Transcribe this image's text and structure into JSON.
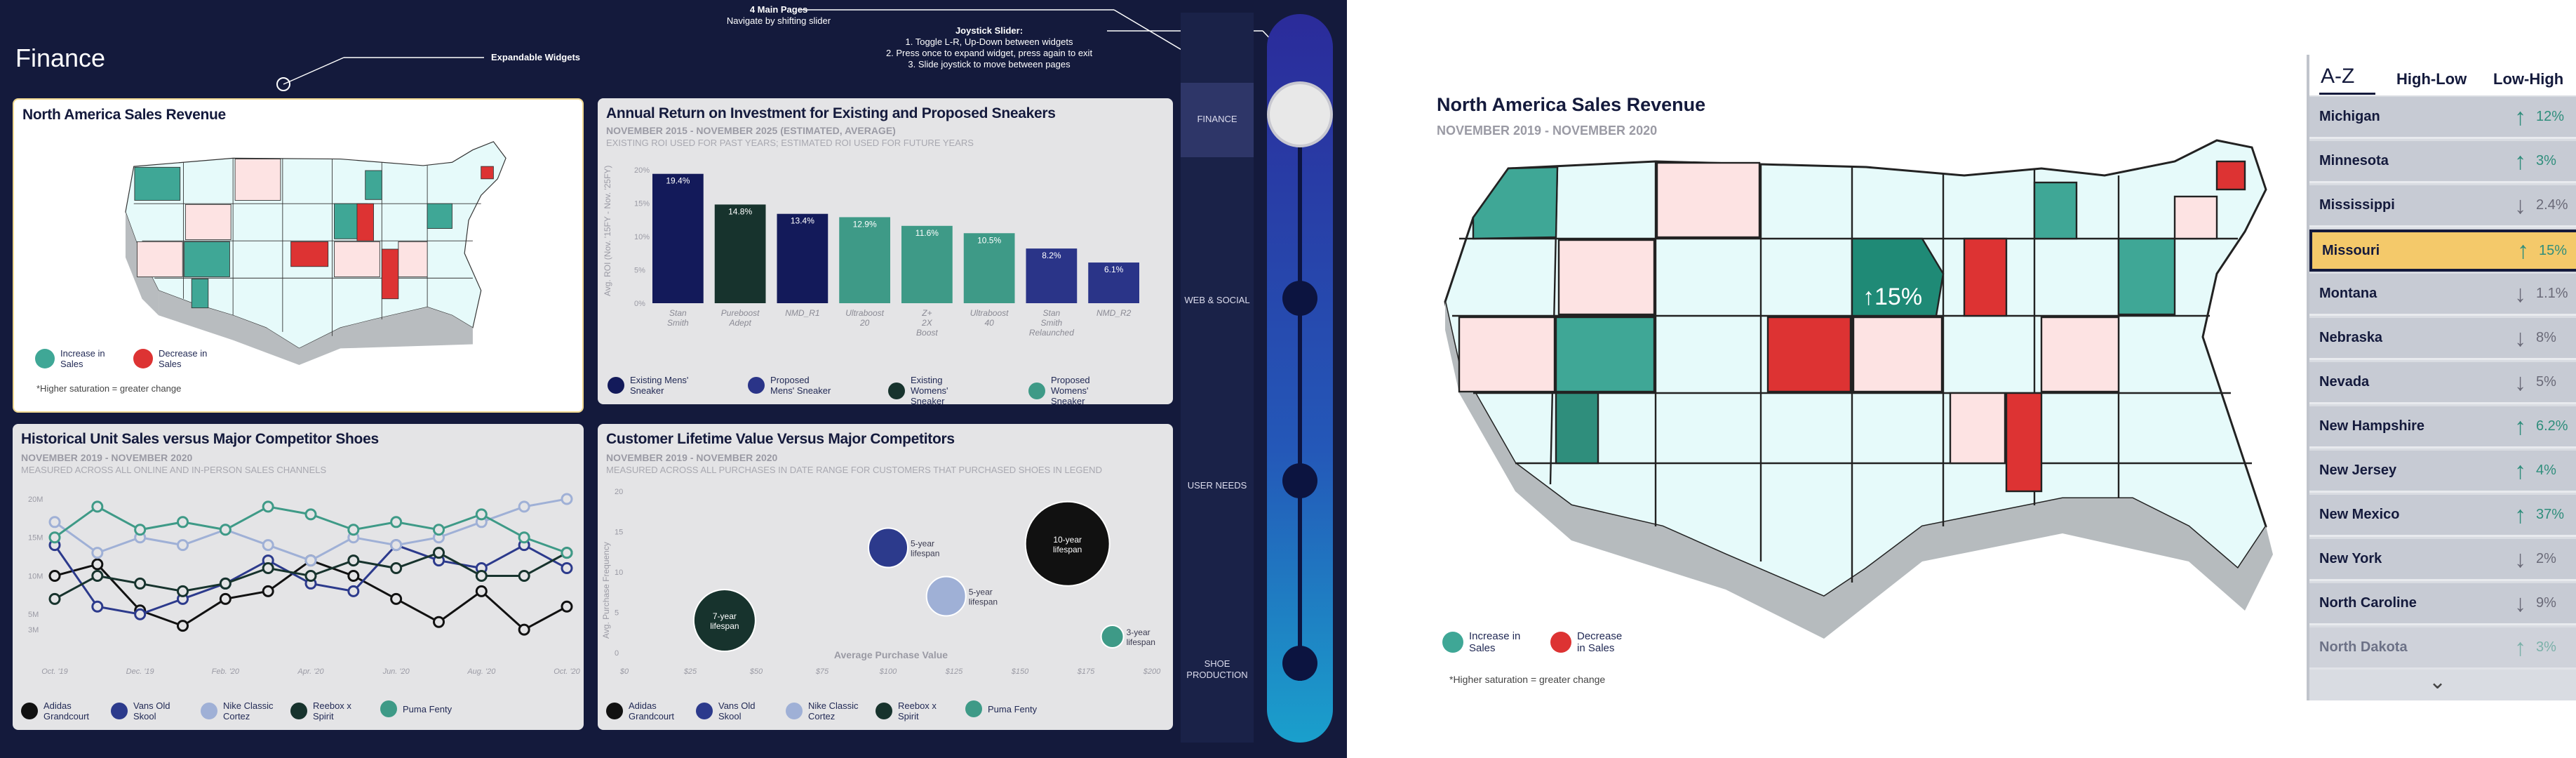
{
  "dashboard": {
    "title": "Finance",
    "callouts": {
      "expandable": "Expandable Widgets",
      "main_pages_title": "4 Main Pages",
      "main_pages_sub": "Navigate by shifting slider",
      "joystick_title": "Joystick Slider:",
      "joystick_lines": [
        "1. Toggle L-R, Up-Down between widgets",
        "2. Press once to expand widget, press again to exit",
        "3. Slide joystick to move between pages"
      ]
    },
    "nav": [
      "FINANCE",
      "WEB & SOCIAL",
      "USER NEEDS",
      "SHOE PRODUCTION"
    ],
    "map_widget": {
      "title": "North America Sales Revenue",
      "legend": [
        "Increase in Sales",
        "Decrease in Sales"
      ],
      "note": "*Higher saturation = greater change"
    },
    "roi_widget": {
      "title": "Annual Return on Investment for Existing and Proposed Sneakers",
      "subtitle": "NOVEMBER 2015 - NOVEMBER 2025 (ESTIMATED, AVERAGE)",
      "subtitle2": "EXISTING ROI USED FOR PAST YEARS; ESTIMATED ROI USED FOR FUTURE YEARS",
      "ylabel": "Avg. ROI (Nov. '15FY - Nov. '25FY)",
      "legend": [
        "Existing Mens' Sneaker",
        "Proposed Mens' Sneaker",
        "Existing Womens' Sneaker",
        "Proposed Womens' Sneaker"
      ]
    },
    "unit_widget": {
      "title": "Historical Unit Sales versus Major Competitor Shoes",
      "subtitle": "NOVEMBER 2019 - NOVEMBER 2020",
      "subtitle2": "MEASURED ACROSS ALL ONLINE AND IN-PERSON SALES CHANNELS",
      "legend": [
        "Adidas Grandcourt",
        "Vans Old Skool",
        "Nike Classic Cortez",
        "Reebox x Spirit",
        "Puma Fenty"
      ]
    },
    "clv_widget": {
      "title": "Customer Lifetime Value Versus Major Competitors",
      "subtitle": "NOVEMBER 2019 - NOVEMBER 2020",
      "subtitle2": "MEASURED ACROSS ALL PURCHASES IN DATE RANGE FOR CUSTOMERS THAT PURCHASED SHOES IN LEGEND",
      "xlabel": "Average Purchase Value",
      "ylabel": "Avg. Purchase Frequency",
      "legend": [
        "Adidas Grandcourt",
        "Vans Old Skool",
        "Nike Classic Cortez",
        "Reebox x Spirit",
        "Puma Fenty"
      ]
    }
  },
  "chart_data": [
    {
      "type": "bar",
      "title": "Annual Return on Investment for Existing and Proposed Sneakers",
      "categories": [
        "Stan Smith",
        "Pureboost Adept",
        "NMD_R1",
        "Ultraboost 20",
        "Z+ 2X Boost",
        "Ultraboost 40",
        "Stan Smith Relaunched",
        "NMD_R2"
      ],
      "values": [
        19.4,
        14.8,
        13.4,
        12.9,
        11.6,
        10.5,
        8.2,
        6.1
      ],
      "value_labels": [
        "19.4%",
        "14.8%",
        "13.4%",
        "12.9%",
        "11.6%",
        "10.5%",
        "8.2%",
        "6.1%"
      ],
      "colors": [
        "#131a5a",
        "#17332d",
        "#131a5a",
        "#3e9a87",
        "#3e9a87",
        "#3e9a87",
        "#2a3488",
        "#2a3488"
      ],
      "yticks": [
        "0%",
        "5%",
        "10%",
        "15%",
        "20%"
      ],
      "ylim": [
        0,
        20
      ]
    },
    {
      "type": "line",
      "title": "Historical Unit Sales versus Major Competitor Shoes",
      "categories": [
        "Oct. '19",
        "Nov. '19",
        "Dec. '19",
        "Jan. '20",
        "Feb. '20",
        "Mar. '20",
        "Apr. '20",
        "May '20",
        "Jun. '20",
        "Jul. '20",
        "Aug. '20",
        "Sep. '20",
        "Oct. '20"
      ],
      "xticks": [
        "Oct. '19",
        "Dec. '19",
        "Feb. '20",
        "Apr. '20",
        "Jun. '20",
        "Aug. '20",
        "Oct. '20"
      ],
      "yticks": [
        "3M",
        "5M",
        "10M",
        "15M",
        "20M"
      ],
      "ylim": [
        0,
        21
      ],
      "series": [
        {
          "name": "Adidas Grandcourt",
          "color": "#111111",
          "values": [
            10,
            11.5,
            5.5,
            3.5,
            7,
            8,
            12,
            10,
            7,
            4,
            8,
            3,
            6
          ]
        },
        {
          "name": "Vans Old Skool",
          "color": "#2c3a8c",
          "values": [
            14,
            6,
            5,
            7,
            9,
            12,
            9,
            8,
            14,
            12,
            11,
            14,
            11
          ]
        },
        {
          "name": "Nike Classic Cortez",
          "color": "#9fb0d6",
          "values": [
            17,
            13,
            15,
            14,
            16,
            14,
            12,
            15,
            14,
            15,
            17,
            19,
            20
          ]
        },
        {
          "name": "Reebox x Spirit",
          "color": "#17332d",
          "values": [
            7,
            10,
            9,
            8,
            9,
            11,
            10,
            12,
            11,
            13,
            10,
            10,
            13
          ]
        },
        {
          "name": "Puma Fenty",
          "color": "#3e9a87",
          "values": [
            15,
            19,
            16,
            17,
            16,
            19,
            18,
            16,
            17,
            16,
            18,
            15,
            13
          ]
        }
      ]
    },
    {
      "type": "scatter",
      "title": "Customer Lifetime Value Versus Major Competitors",
      "xlabel": "Average Purchase Value",
      "ylabel": "Avg. Purchase Frequency",
      "xticks": [
        "$0",
        "$25",
        "$50",
        "$75",
        "$100",
        "$125",
        "$150",
        "$175",
        "$200"
      ],
      "yticks": [
        "0",
        "5",
        "10",
        "15",
        "20"
      ],
      "xlim": [
        0,
        200
      ],
      "ylim": [
        0,
        20
      ],
      "points": [
        {
          "label": "7-year lifespan",
          "x": 38,
          "y": 4,
          "r": 44,
          "color": "#17332d",
          "text_inside": true
        },
        {
          "label": "5-year lifespan",
          "x": 100,
          "y": 13,
          "r": 28,
          "color": "#2c3a8c",
          "text_inside": false
        },
        {
          "label": "5-year lifespan",
          "x": 122,
          "y": 7,
          "r": 28,
          "color": "#9fb0d6",
          "text_inside": false
        },
        {
          "label": "10-year lifespan",
          "x": 168,
          "y": 13.5,
          "r": 60,
          "color": "#111111",
          "text_inside": true
        },
        {
          "label": "3-year lifespan",
          "x": 185,
          "y": 2,
          "r": 16,
          "color": "#3e9a87",
          "text_inside": false
        }
      ]
    }
  ],
  "detail": {
    "title": "North America Sales Revenue",
    "subtitle": "NOVEMBER 2019 - NOVEMBER 2020",
    "map_label": "↑15%",
    "legend": [
      "Increase in Sales",
      "Decrease in Sales"
    ],
    "note": "*Higher saturation = greater change",
    "sort_options": [
      "A-Z",
      "High-Low",
      "Low-High"
    ],
    "states": [
      {
        "name": "Michigan",
        "dir": "↑",
        "pct": "12%"
      },
      {
        "name": "Minnesota",
        "dir": "↑",
        "pct": "3%"
      },
      {
        "name": "Mississippi",
        "dir": "↓",
        "pct": "2.4%"
      },
      {
        "name": "Missouri",
        "dir": "↑",
        "pct": "15%"
      },
      {
        "name": "Montana",
        "dir": "↓",
        "pct": "1.1%"
      },
      {
        "name": "Nebraska",
        "dir": "↓",
        "pct": "8%"
      },
      {
        "name": "Nevada",
        "dir": "↓",
        "pct": "5%"
      },
      {
        "name": "New Hampshire",
        "dir": "↑",
        "pct": "6.2%"
      },
      {
        "name": "New Jersey",
        "dir": "↑",
        "pct": "4%"
      },
      {
        "name": "New Mexico",
        "dir": "↑",
        "pct": "37%"
      },
      {
        "name": "New York",
        "dir": "↓",
        "pct": "2%"
      },
      {
        "name": "North Caroline",
        "dir": "↓",
        "pct": "9%"
      },
      {
        "name": "North Dakota",
        "dir": "↑",
        "pct": "3%"
      }
    ],
    "colors": {
      "increase": "#3fa796",
      "decrease": "#dd3333",
      "up_arrow": "#2f8e7c",
      "down_arrow": "#6a6a78",
      "selected": "#f4c96a"
    }
  }
}
